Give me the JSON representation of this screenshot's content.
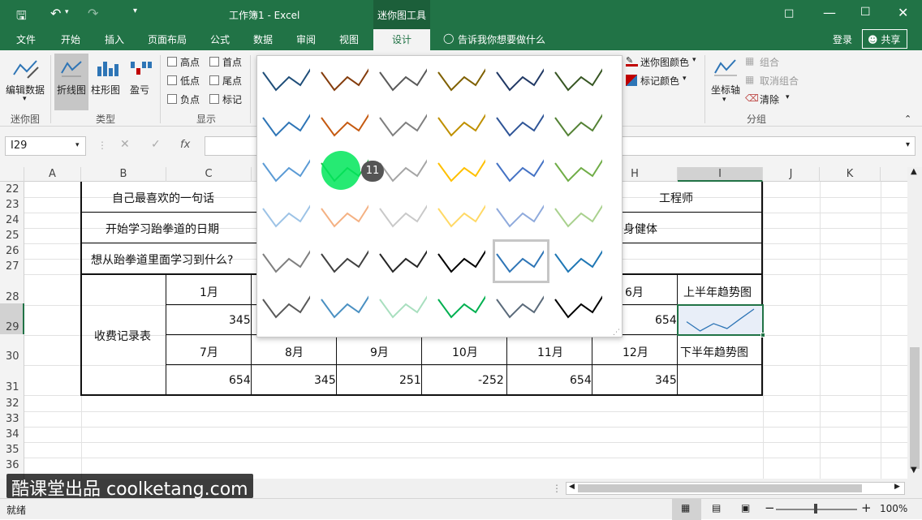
{
  "title_bar": {
    "title": "工作簿1 - Excel",
    "context_tab": "迷你图工具",
    "undo_icon": "undo-icon",
    "redo_icon": "redo-icon"
  },
  "tabs": [
    "文件",
    "开始",
    "插入",
    "页面布局",
    "公式",
    "数据",
    "审阅",
    "视图",
    "设计"
  ],
  "tell_me": "告诉我你想要做什么",
  "login": "登录",
  "share": "共享",
  "ribbon": {
    "edit_data": "编辑数据",
    "sparkline_group": "迷你图",
    "type_line": "折线图",
    "type_column": "柱形图",
    "type_winloss": "盈亏",
    "type_group": "类型",
    "show_high": "高点",
    "show_first": "首点",
    "show_low": "低点",
    "show_last": "尾点",
    "show_negative": "负点",
    "show_markers": "标记",
    "show_group": "显示",
    "sparkline_color": "迷你图颜色",
    "marker_color": "标记颜色",
    "axis": "坐标轴",
    "group_btn": "组合",
    "ungroup_btn": "取消组合",
    "clear_btn": "清除",
    "grouping_group": "分组"
  },
  "name_box": "I29",
  "fx": "fx",
  "columns": [
    "A",
    "B",
    "C",
    "D",
    "E",
    "F",
    "G",
    "H",
    "I",
    "J",
    "K"
  ],
  "rows": [
    "22",
    "23",
    "24",
    "25",
    "26",
    "27",
    "28",
    "29",
    "30",
    "31",
    "32",
    "33",
    "34",
    "35",
    "36"
  ],
  "cells": {
    "b22": "自己最喜欢的一句话",
    "h22": "工程师",
    "b24": "开始学习跆拳道的日期",
    "h24": "身健体",
    "b26": "想从跆拳道里面学习到什么?",
    "b29": "收费记录表",
    "c28": "1月",
    "h28": "6月",
    "i28": "上半年趋势图",
    "c29": "345",
    "h29": "654",
    "c30": "7月",
    "d30": "8月",
    "e30": "9月",
    "f30": "10月",
    "g30": "11月",
    "h30": "12月",
    "i30": "下半年趋势图",
    "c31": "654",
    "d31": "345",
    "e31": "251",
    "f31": "-252",
    "g31": "654",
    "h31": "345"
  },
  "sparkline_data": [
    345,
    120,
    300,
    180,
    420,
    654
  ],
  "gallery_colors": [
    [
      "#1f4e79",
      "#843c0c",
      "#595959",
      "#7f6000",
      "#203864",
      "#375623"
    ],
    [
      "#2e75b6",
      "#c55a11",
      "#7f7f7f",
      "#bf9000",
      "#2f5597",
      "#548235"
    ],
    [
      "#5b9bd5",
      "#2cb34a",
      "#a5a5a5",
      "#ffc000",
      "#4472c4",
      "#70ad47"
    ],
    [
      "#9dc3e6",
      "#f4b183",
      "#c9c9c9",
      "#ffd966",
      "#8faadc",
      "#a9d18e"
    ],
    [
      "#7f7f7f",
      "#404040",
      "#262626",
      "#000000",
      "#2e75b6",
      "#1f77b4"
    ],
    [
      "#595959",
      "#4a90c2",
      "#a9dfbf",
      "#00b050",
      "#5a6a7a",
      "#000000"
    ]
  ],
  "cursor_badge": "11",
  "status": "就绪",
  "zoom": "100%",
  "watermark": "酷课堂出品 coolketang.com"
}
